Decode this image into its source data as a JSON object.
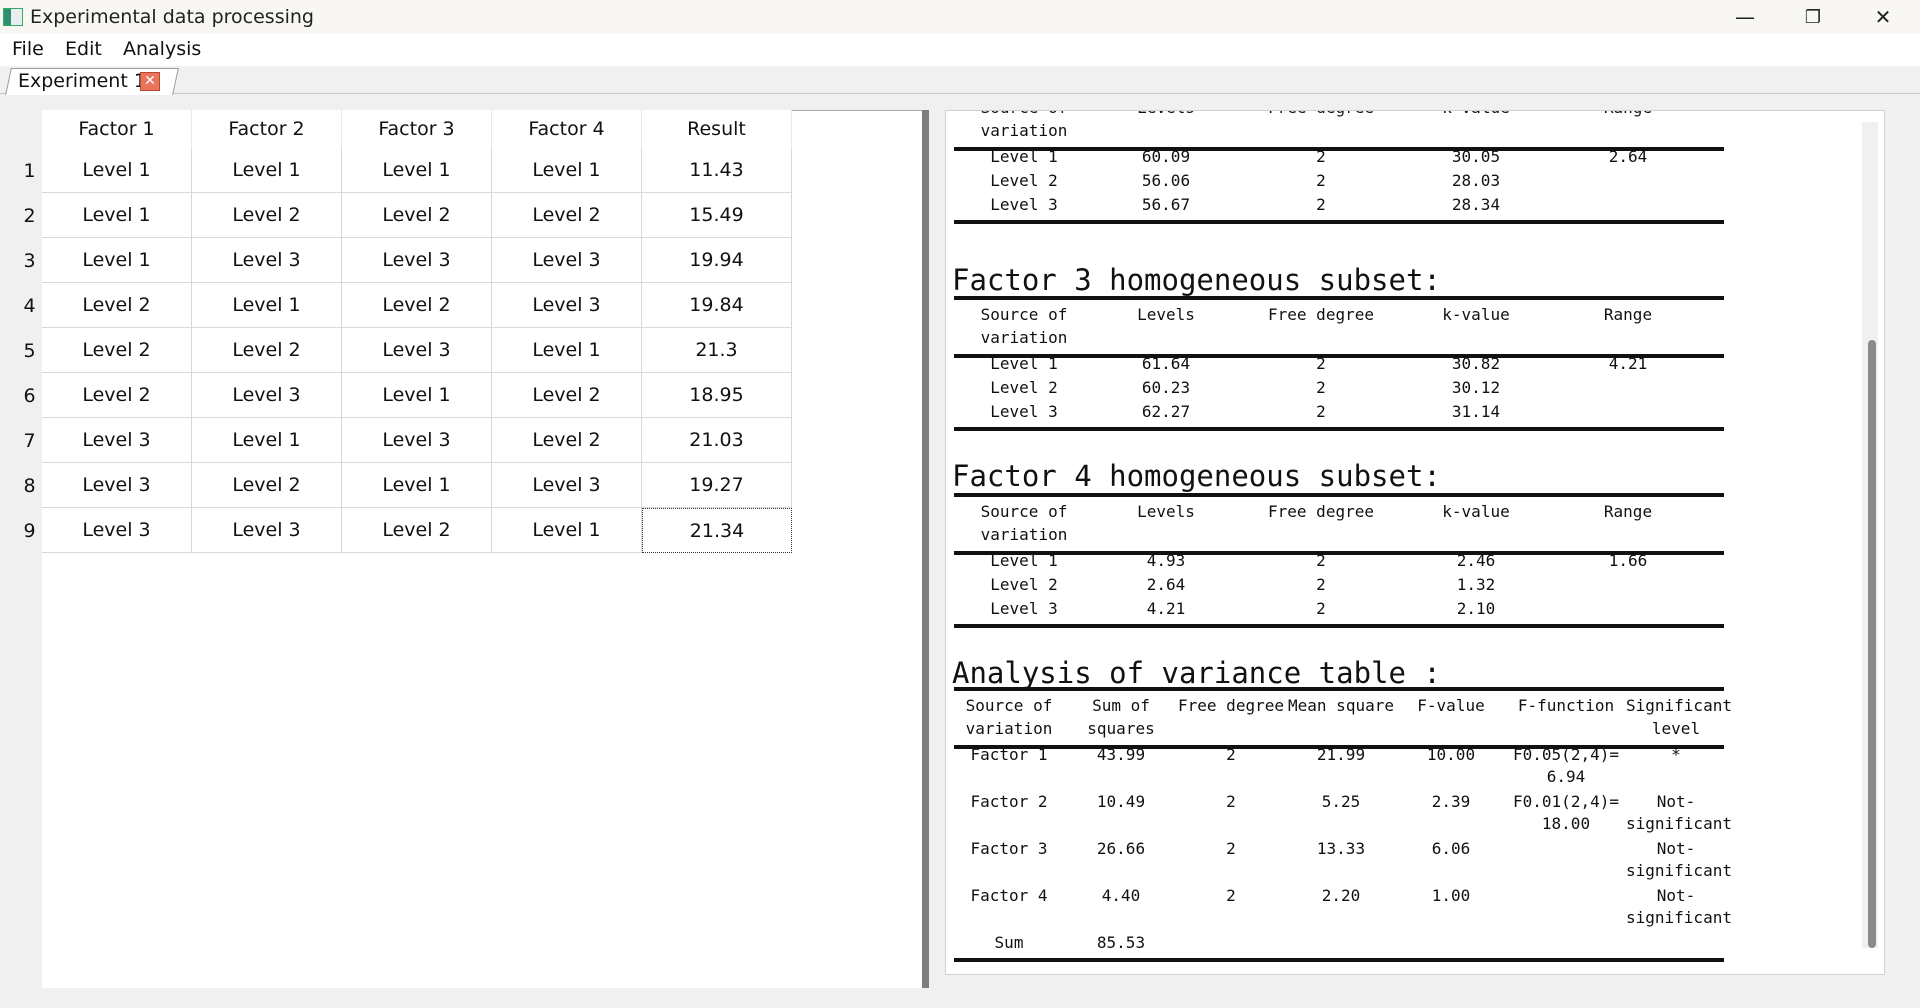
{
  "window": {
    "title": "Experimental data processing",
    "minimize": "—",
    "restore": "❐",
    "close": "✕"
  },
  "menu": {
    "file": "File",
    "edit": "Edit",
    "analysis": "Analysis"
  },
  "tab": {
    "label": "Experiment 1",
    "close": "✕"
  },
  "grid": {
    "headers": [
      "Factor 1",
      "Factor 2",
      "Factor 3",
      "Factor 4",
      "Result"
    ],
    "rows": [
      {
        "n": "1",
        "c": [
          "Level 1",
          "Level 1",
          "Level 1",
          "Level 1",
          "11.43"
        ]
      },
      {
        "n": "2",
        "c": [
          "Level 1",
          "Level 2",
          "Level 2",
          "Level 2",
          "15.49"
        ]
      },
      {
        "n": "3",
        "c": [
          "Level 1",
          "Level 3",
          "Level 3",
          "Level 3",
          "19.94"
        ]
      },
      {
        "n": "4",
        "c": [
          "Level 2",
          "Level 1",
          "Level 2",
          "Level 3",
          "19.84"
        ]
      },
      {
        "n": "5",
        "c": [
          "Level 2",
          "Level 2",
          "Level 3",
          "Level 1",
          "21.3"
        ]
      },
      {
        "n": "6",
        "c": [
          "Level 2",
          "Level 3",
          "Level 1",
          "Level 2",
          "18.95"
        ]
      },
      {
        "n": "7",
        "c": [
          "Level 3",
          "Level 1",
          "Level 3",
          "Level 2",
          "21.03"
        ]
      },
      {
        "n": "8",
        "c": [
          "Level 3",
          "Level 2",
          "Level 1",
          "Level 3",
          "19.27"
        ]
      },
      {
        "n": "9",
        "c": [
          "Level 3",
          "Level 3",
          "Level 2",
          "Level 1",
          "21.34"
        ]
      }
    ]
  },
  "report": {
    "subset_headers": {
      "source": "Source of",
      "source2": "variation",
      "levels": "Levels",
      "free": "Free degree",
      "k": "k-value",
      "range": "Range"
    },
    "factor2": {
      "rows": [
        {
          "name": "Level 1",
          "levels": "60.09",
          "free": "2",
          "k": "30.05",
          "range": "2.64"
        },
        {
          "name": "Level 2",
          "levels": "56.06",
          "free": "2",
          "k": "28.03",
          "range": ""
        },
        {
          "name": "Level 3",
          "levels": "56.67",
          "free": "2",
          "k": "28.34",
          "range": ""
        }
      ]
    },
    "factor3": {
      "title": "Factor 3 homogeneous subset:",
      "rows": [
        {
          "name": "Level 1",
          "levels": "61.64",
          "free": "2",
          "k": "30.82",
          "range": "4.21"
        },
        {
          "name": "Level 2",
          "levels": "60.23",
          "free": "2",
          "k": "30.12",
          "range": ""
        },
        {
          "name": "Level 3",
          "levels": "62.27",
          "free": "2",
          "k": "31.14",
          "range": ""
        }
      ]
    },
    "factor4": {
      "title": "Factor 4 homogeneous subset:",
      "rows": [
        {
          "name": "Level 1",
          "levels": "4.93",
          "free": "2",
          "k": "2.46",
          "range": "1.66"
        },
        {
          "name": "Level 2",
          "levels": "2.64",
          "free": "2",
          "k": "1.32",
          "range": ""
        },
        {
          "name": "Level 3",
          "levels": "4.21",
          "free": "2",
          "k": "2.10",
          "range": ""
        }
      ]
    },
    "anova": {
      "title": "Analysis of variance table :",
      "headers": {
        "source": "Source of",
        "source2": "variation",
        "ss": "Sum of",
        "ss2": "squares",
        "free": "Free degree",
        "ms": "Mean square",
        "f": "F-value",
        "ff": "F-function",
        "sig": "Significant",
        "sig2": "level"
      },
      "rows": [
        {
          "name": "Factor 1",
          "ss": "43.99",
          "free": "2",
          "ms": "21.99",
          "f": "10.00",
          "ff1": "F0.05(2,4)=",
          "ff2": "6.94",
          "sig1": "*",
          "sig2": ""
        },
        {
          "name": "Factor 2",
          "ss": "10.49",
          "free": "2",
          "ms": "5.25",
          "f": "2.39",
          "ff1": "F0.01(2,4)=",
          "ff2": "18.00",
          "sig1": "Not-",
          "sig2": "significant"
        },
        {
          "name": "Factor 3",
          "ss": "26.66",
          "free": "2",
          "ms": "13.33",
          "f": "6.06",
          "ff1": "",
          "ff2": "",
          "sig1": "Not-",
          "sig2": "significant"
        },
        {
          "name": "Factor 4",
          "ss": "4.40",
          "free": "2",
          "ms": "2.20",
          "f": "1.00",
          "ff1": "",
          "ff2": "",
          "sig1": "Not-",
          "sig2": "significant"
        }
      ],
      "sum_label": "Sum",
      "sum_value": "85.53"
    }
  }
}
